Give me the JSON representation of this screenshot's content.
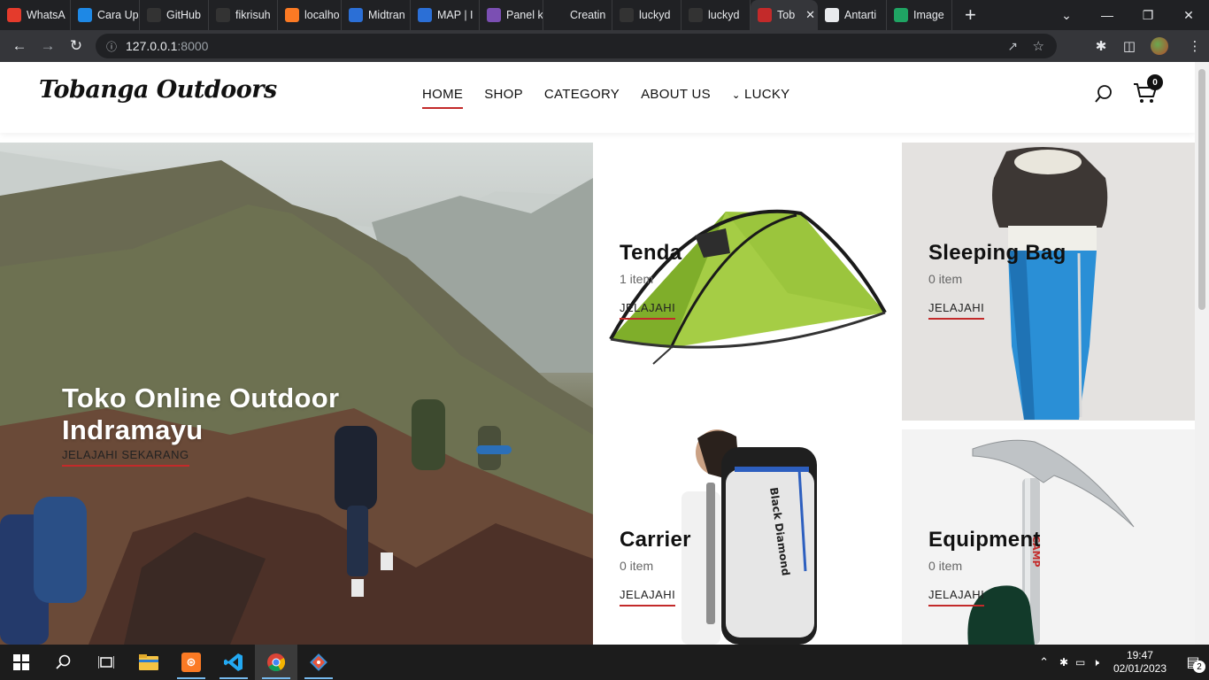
{
  "browser": {
    "tabs": [
      {
        "title": "WhatsA",
        "icon": "whatsapp-icon",
        "color": "#e43b2c"
      },
      {
        "title": "Cara Up",
        "icon": "pycharm-icon",
        "color": "#1e88e5"
      },
      {
        "title": "GitHub",
        "icon": "github-icon",
        "color": "#333333"
      },
      {
        "title": "fikrisuh",
        "icon": "github-icon",
        "color": "#333333"
      },
      {
        "title": "localho",
        "icon": "xampp-icon",
        "color": "#fb7a24"
      },
      {
        "title": "Midtran",
        "icon": "midtrans-icon",
        "color": "#2b6fd6"
      },
      {
        "title": "MAP | I",
        "icon": "midtrans-icon",
        "color": "#2b6fd6"
      },
      {
        "title": "Panel k",
        "icon": "rc-icon",
        "color": "#7b4fb3"
      },
      {
        "title": "Creatin",
        "icon": "blank-icon",
        "color": "#202124"
      },
      {
        "title": "luckyd",
        "icon": "github-icon",
        "color": "#333333"
      },
      {
        "title": "luckyd",
        "icon": "github-icon",
        "color": "#333333"
      },
      {
        "title": "Tob",
        "icon": "site-icon",
        "color": "#c32a2a",
        "active": true
      },
      {
        "title": "Antarti",
        "icon": "antartica-icon",
        "color": "#e8eaed"
      },
      {
        "title": "Image",
        "icon": "google-drive-icon",
        "color": "#1fa463"
      }
    ],
    "url_host": "127.0.0.1",
    "url_port": ":8000"
  },
  "site": {
    "logo": "Tobanga Outdoors",
    "menu": {
      "home": "HOME",
      "shop": "SHOP",
      "category": "CATEGORY",
      "about": "ABOUT US",
      "user": "LUCKY"
    },
    "cart_count": "0"
  },
  "hero": {
    "title_line1": "Toko Online Outdoor",
    "title_line2": "Indramayu",
    "cta": "JELAJAHI SEKARANG"
  },
  "categories": [
    {
      "name": "Tenda",
      "count": "1 item",
      "cta": "JELAJAHI"
    },
    {
      "name": "Sleeping Bag",
      "count": "0 item",
      "cta": "JELAJAHI"
    },
    {
      "name": "Carrier",
      "count": "0 item",
      "cta": "JELAJAHI"
    },
    {
      "name": "Equipment",
      "count": "0 item",
      "cta": "JELAJAHI"
    }
  ],
  "taskbar": {
    "time": "19:47",
    "date": "02/01/2023",
    "notifications": "2"
  },
  "colors": {
    "accent_red": "#c32a2a",
    "tab_bar": "#202124",
    "toolbar": "#35363a"
  }
}
